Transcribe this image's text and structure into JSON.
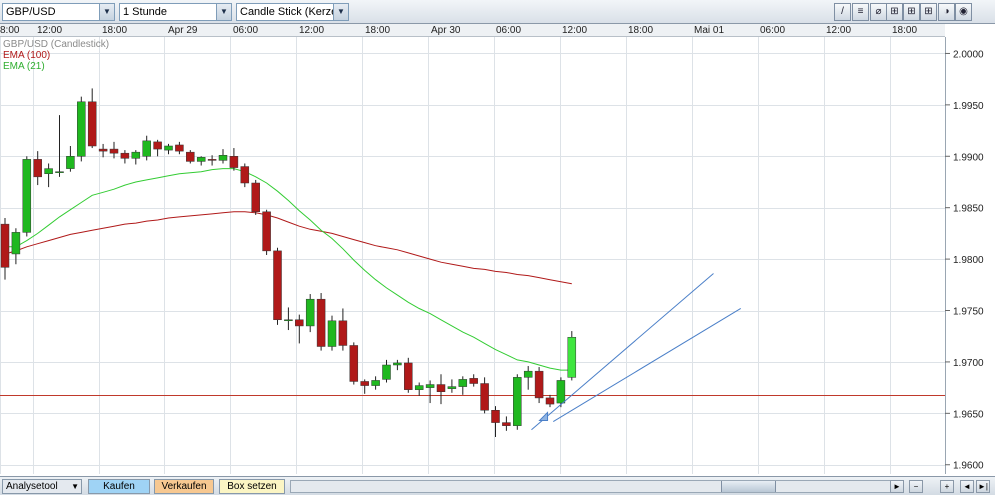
{
  "toolbar": {
    "symbol": "GBP/USD",
    "interval": "1 Stunde",
    "chart_type": "Candle Stick (Kerze",
    "dropdown_arrow": "▼",
    "tools": [
      "/",
      "≡",
      "⌀",
      "⊞",
      "⊞",
      "⊞",
      "◑",
      "◉"
    ]
  },
  "time_axis_labels": [
    "8:00",
    "12:00",
    "18:00",
    "Apr 29",
    "06:00",
    "12:00",
    "18:00",
    "Apr 30",
    "06:00",
    "12:00",
    "18:00",
    "Mai 01",
    "06:00",
    "12:00",
    "18:00"
  ],
  "legend": {
    "main": "GBP/USD (Candlestick)",
    "ema100": "EMA (100)",
    "ema21": "EMA (21)"
  },
  "colors": {
    "up": "#1fb81f",
    "up_last": "#3ee63e",
    "down": "#b01919",
    "ema100": "#b01919",
    "ema21": "#33cc33",
    "channel": "#4a7fc8",
    "hline": "#c0392b",
    "grid": "#dde2e7"
  },
  "bottombar": {
    "analyse": "Analysetool",
    "kaufen": "Kaufen",
    "verkaufen": "Verkaufen",
    "box": "Box setzen",
    "scroll_left": "◄",
    "scroll_right": "►",
    "zoom_out": "−",
    "zoom_in": "+",
    "scroll_end": "►|"
  },
  "chart_data": {
    "type": "candlestick",
    "title": "GBP/USD (Candlestick)",
    "y_ticks": [
      "2.0000",
      "1.9950",
      "1.9900",
      "1.9850",
      "1.9800",
      "1.9750",
      "1.9700",
      "1.9650",
      "1.9600"
    ],
    "ylim": [
      1.9591,
      2.0016
    ],
    "grid": true,
    "horizontal_line": 1.9668,
    "candles": [
      {
        "o": 1.9834,
        "h": 1.984,
        "l": 1.978,
        "c": 1.9792
      },
      {
        "o": 1.9805,
        "h": 1.983,
        "l": 1.9795,
        "c": 1.9826
      },
      {
        "o": 1.9826,
        "h": 1.99,
        "l": 1.9822,
        "c": 1.9897
      },
      {
        "o": 1.9897,
        "h": 1.9905,
        "l": 1.9872,
        "c": 1.988
      },
      {
        "o": 1.9883,
        "h": 1.9893,
        "l": 1.987,
        "c": 1.9888
      },
      {
        "o": 1.9885,
        "h": 1.994,
        "l": 1.988,
        "c": 1.9885
      },
      {
        "o": 1.9888,
        "h": 1.991,
        "l": 1.9885,
        "c": 1.99
      },
      {
        "o": 1.99,
        "h": 1.9958,
        "l": 1.9895,
        "c": 1.9953
      },
      {
        "o": 1.9953,
        "h": 1.9966,
        "l": 1.9908,
        "c": 1.991
      },
      {
        "o": 1.9907,
        "h": 1.9912,
        "l": 1.9899,
        "c": 1.9905
      },
      {
        "o": 1.9907,
        "h": 1.9914,
        "l": 1.9898,
        "c": 1.9903
      },
      {
        "o": 1.9903,
        "h": 1.9906,
        "l": 1.9893,
        "c": 1.9898
      },
      {
        "o": 1.9898,
        "h": 1.9906,
        "l": 1.9892,
        "c": 1.9904
      },
      {
        "o": 1.99,
        "h": 1.992,
        "l": 1.9896,
        "c": 1.9915
      },
      {
        "o": 1.9914,
        "h": 1.9916,
        "l": 1.99,
        "c": 1.9907
      },
      {
        "o": 1.9906,
        "h": 1.9912,
        "l": 1.9902,
        "c": 1.991
      },
      {
        "o": 1.9911,
        "h": 1.9914,
        "l": 1.9902,
        "c": 1.9905
      },
      {
        "o": 1.9904,
        "h": 1.9906,
        "l": 1.9893,
        "c": 1.9895
      },
      {
        "o": 1.9895,
        "h": 1.99,
        "l": 1.9891,
        "c": 1.9899
      },
      {
        "o": 1.9897,
        "h": 1.9901,
        "l": 1.9891,
        "c": 1.9896
      },
      {
        "o": 1.9896,
        "h": 1.9907,
        "l": 1.9893,
        "c": 1.9901
      },
      {
        "o": 1.99,
        "h": 1.9908,
        "l": 1.9886,
        "c": 1.9889
      },
      {
        "o": 1.989,
        "h": 1.9893,
        "l": 1.987,
        "c": 1.9874
      },
      {
        "o": 1.9874,
        "h": 1.9877,
        "l": 1.9843,
        "c": 1.9846
      },
      {
        "o": 1.9846,
        "h": 1.9848,
        "l": 1.9804,
        "c": 1.9808
      },
      {
        "o": 1.9808,
        "h": 1.9811,
        "l": 1.9736,
        "c": 1.9741
      },
      {
        "o": 1.9741,
        "h": 1.9753,
        "l": 1.9731,
        "c": 1.9741
      },
      {
        "o": 1.9741,
        "h": 1.9746,
        "l": 1.9718,
        "c": 1.9735
      },
      {
        "o": 1.9735,
        "h": 1.9766,
        "l": 1.9729,
        "c": 1.9761
      },
      {
        "o": 1.9761,
        "h": 1.9767,
        "l": 1.9711,
        "c": 1.9715
      },
      {
        "o": 1.9715,
        "h": 1.9745,
        "l": 1.9711,
        "c": 1.974
      },
      {
        "o": 1.974,
        "h": 1.9752,
        "l": 1.9711,
        "c": 1.9716
      },
      {
        "o": 1.9716,
        "h": 1.9719,
        "l": 1.9678,
        "c": 1.9681
      },
      {
        "o": 1.9681,
        "h": 1.9683,
        "l": 1.9669,
        "c": 1.9677
      },
      {
        "o": 1.9677,
        "h": 1.9686,
        "l": 1.9673,
        "c": 1.9682
      },
      {
        "o": 1.9683,
        "h": 1.9702,
        "l": 1.968,
        "c": 1.9697
      },
      {
        "o": 1.9697,
        "h": 1.9702,
        "l": 1.9692,
        "c": 1.9699
      },
      {
        "o": 1.9699,
        "h": 1.9704,
        "l": 1.967,
        "c": 1.9673
      },
      {
        "o": 1.9673,
        "h": 1.968,
        "l": 1.9667,
        "c": 1.9677
      },
      {
        "o": 1.9675,
        "h": 1.9682,
        "l": 1.966,
        "c": 1.9678
      },
      {
        "o": 1.9678,
        "h": 1.9688,
        "l": 1.9659,
        "c": 1.9671
      },
      {
        "o": 1.9674,
        "h": 1.9683,
        "l": 1.967,
        "c": 1.9676
      },
      {
        "o": 1.9676,
        "h": 1.9686,
        "l": 1.9668,
        "c": 1.9683
      },
      {
        "o": 1.9684,
        "h": 1.9688,
        "l": 1.9676,
        "c": 1.9679
      },
      {
        "o": 1.9679,
        "h": 1.9685,
        "l": 1.965,
        "c": 1.9653
      },
      {
        "o": 1.9653,
        "h": 1.9657,
        "l": 1.9627,
        "c": 1.9641
      },
      {
        "o": 1.9641,
        "h": 1.9647,
        "l": 1.9633,
        "c": 1.9638
      },
      {
        "o": 1.9638,
        "h": 1.9688,
        "l": 1.9634,
        "c": 1.9685
      },
      {
        "o": 1.9685,
        "h": 1.9696,
        "l": 1.9673,
        "c": 1.9691
      },
      {
        "o": 1.9691,
        "h": 1.9695,
        "l": 1.966,
        "c": 1.9665
      },
      {
        "o": 1.9665,
        "h": 1.9668,
        "l": 1.9656,
        "c": 1.9659
      },
      {
        "o": 1.966,
        "h": 1.9685,
        "l": 1.9656,
        "c": 1.9682
      },
      {
        "o": 1.9685,
        "h": 1.973,
        "l": 1.9682,
        "c": 1.9724
      }
    ],
    "ema100": [
      1.9805,
      1.9808,
      1.9812,
      1.9815,
      1.9818,
      1.9821,
      1.9824,
      1.9826,
      1.9828,
      1.983,
      1.9832,
      1.9834,
      1.9835,
      1.9837,
      1.9838,
      1.984,
      1.9841,
      1.9842,
      1.9843,
      1.9844,
      1.9845,
      1.9846,
      1.9846,
      1.9845,
      1.9843,
      1.984,
      1.9836,
      1.9832,
      1.9829,
      1.9827,
      1.9825,
      1.9822,
      1.9819,
      1.9816,
      1.9813,
      1.9811,
      1.9809,
      1.9806,
      1.9803,
      1.98,
      1.9797,
      1.9795,
      1.9793,
      1.9791,
      1.979,
      1.9788,
      1.9787,
      1.9785,
      1.9784,
      1.9782,
      1.978,
      1.9778,
      1.9776
    ],
    "ema21": [
      1.9812,
      1.9812,
      1.9818,
      1.9825,
      1.9833,
      1.9841,
      1.9848,
      1.9855,
      1.9862,
      1.9865,
      1.9868,
      1.9872,
      1.9875,
      1.9877,
      1.9879,
      1.9881,
      1.9883,
      1.9884,
      1.9885,
      1.9887,
      1.9888,
      1.9888,
      1.9885,
      1.988,
      1.9874,
      1.9866,
      1.9857,
      1.9847,
      1.9838,
      1.9828,
      1.982,
      1.981,
      1.9799,
      1.9789,
      1.978,
      1.9772,
      1.9765,
      1.9758,
      1.9752,
      1.9747,
      1.9741,
      1.9735,
      1.9729,
      1.9724,
      1.9718,
      1.9712,
      1.9707,
      1.9702,
      1.97,
      1.9697,
      1.9694,
      1.9692,
      1.9692
    ],
    "channel": [
      {
        "x1": 48.3,
        "y1": 1.9634,
        "x2": 65.0,
        "y2": 1.9786
      },
      {
        "x1": 50.3,
        "y1": 1.9642,
        "x2": 67.5,
        "y2": 1.9752
      }
    ]
  }
}
